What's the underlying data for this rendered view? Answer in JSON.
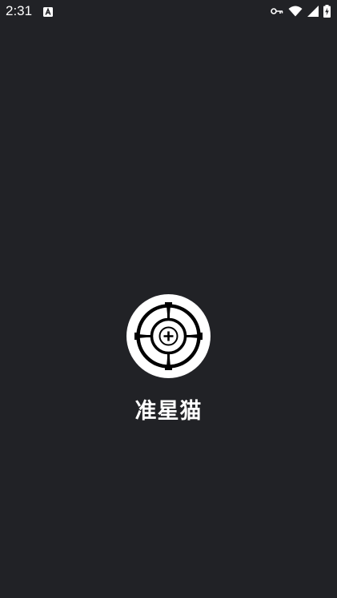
{
  "status_bar": {
    "time": "2:31",
    "notification_icon": "app-notification-icon",
    "icons": [
      "key-icon",
      "wifi-icon",
      "signal-icon",
      "battery-charging-icon"
    ]
  },
  "splash": {
    "logo_icon": "crosshair-logo-icon",
    "app_name": "准星猫"
  },
  "colors": {
    "background": "#212226",
    "foreground": "#ffffff"
  }
}
